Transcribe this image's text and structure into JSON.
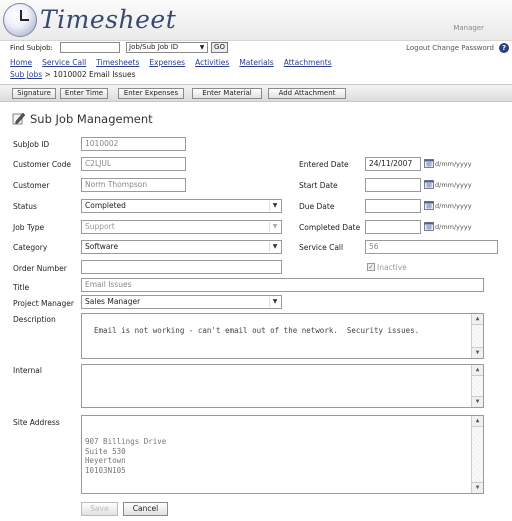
{
  "app": {
    "title": "Timesheet",
    "user": "Manager"
  },
  "findbar": {
    "label": "Find Subjob:",
    "input_value": "",
    "select_value": "Job/Sub Job ID",
    "go_label": "GO",
    "links": [
      "Logout Change Password"
    ]
  },
  "nav": [
    "Home",
    "Service Call",
    "Timesheets",
    "Expenses",
    "Activities",
    "Materials",
    "Attachments"
  ],
  "breadcrumb": {
    "link": "Sub Jobs",
    "sep": ">",
    "current": "1010002 Email Issues"
  },
  "toolbar": [
    "Signature",
    "Enter Time",
    "Enter Expenses",
    "Enter Material",
    "Add Attachment"
  ],
  "section_title": "Sub Job Management",
  "form": {
    "subjob_id": {
      "label": "SubJob ID",
      "value": "1010002"
    },
    "customer_code": {
      "label": "Customer Code",
      "value": "C2LJUL"
    },
    "customer": {
      "label": "Customer",
      "value": "Norm Thompson"
    },
    "status": {
      "label": "Status",
      "value": "Completed"
    },
    "job_type": {
      "label": "Job Type",
      "value": "Support"
    },
    "category": {
      "label": "Category",
      "value": "Software"
    },
    "order_number": {
      "label": "Order Number",
      "value": ""
    },
    "title": {
      "label": "Title",
      "value": "Email Issues"
    },
    "project_manager": {
      "label": "Project Manager",
      "value": "Sales Manager"
    },
    "description": {
      "label": "Description",
      "value": "Email is not working - can't email out of the network.  Security issues."
    },
    "internal": {
      "label": "Internal",
      "value": ""
    },
    "site_address": {
      "label": "Site Address",
      "value": "\n907 Billings Drive\nSuite 530\nHeyertown\n10103N105"
    },
    "entered_date": {
      "label": "Entered Date",
      "value": "24/11/2007",
      "fmt": "d/mm/yyyy"
    },
    "start_date": {
      "label": "Start Date",
      "value": "",
      "fmt": "d/mm/yyyy"
    },
    "due_date": {
      "label": "Due Date",
      "value": "",
      "fmt": "d/mm/yyyy"
    },
    "completed_date": {
      "label": "Completed Date",
      "value": "",
      "fmt": "d/mm/yyyy"
    },
    "service_call": {
      "label": "Service Call",
      "value": "56"
    },
    "inactive": {
      "label": "Inactive",
      "checked": true
    }
  },
  "buttons": {
    "save": "Save",
    "cancel": "Cancel"
  }
}
